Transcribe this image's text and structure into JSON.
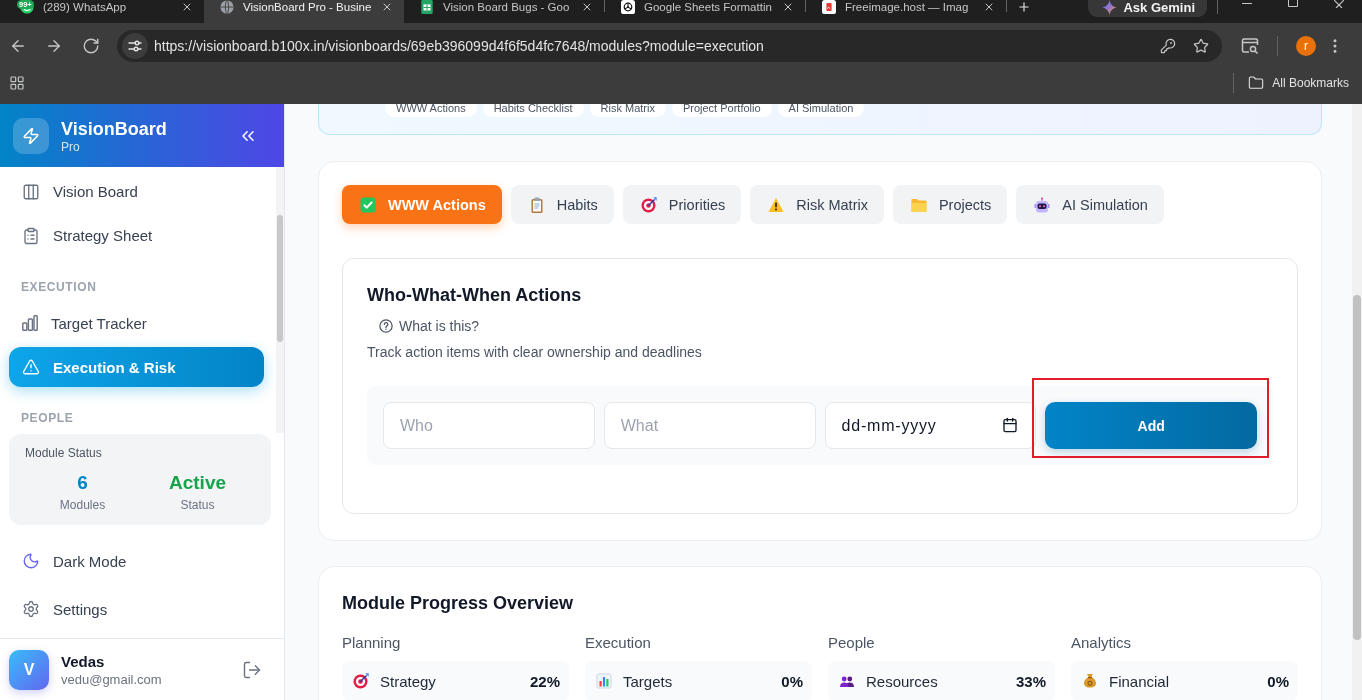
{
  "browser": {
    "tabs": [
      {
        "title": "(289) WhatsApp",
        "kind": "chat",
        "badge": "99+",
        "selected": false
      },
      {
        "title": "VisionBoard Pro - Busine",
        "kind": "globe",
        "selected": true
      },
      {
        "title": "Vision Board Bugs - Goo",
        "kind": "sheet",
        "selected": false
      },
      {
        "title": "Google Sheets Formattin",
        "kind": "knot",
        "selected": false
      },
      {
        "title": "Freeimage.host — Imag",
        "kind": "image",
        "selected": false
      }
    ],
    "assistant_button": "Ask Gemini",
    "url": "https://visionboard.b100x.in/visionboards/69eb396099d4f6f5d4fc7648/modules?module=execution",
    "profile_initial": "r",
    "bookmarks_folder": "All Bookmarks"
  },
  "sidebar": {
    "brand": {
      "name": "VisionBoard",
      "tier": "Pro"
    },
    "groups": [
      {
        "items": [
          {
            "label": "Vision Board",
            "kind": "columns",
            "selected": false
          },
          {
            "label": "Strategy Sheet",
            "kind": "clipboard",
            "selected": false
          }
        ]
      },
      {
        "heading": "EXECUTION",
        "items": [
          {
            "label": "Target Tracker",
            "kind": "chart",
            "selected": false
          },
          {
            "label": "Execution & Risk",
            "kind": "alert",
            "selected": true
          }
        ]
      },
      {
        "heading": "PEOPLE"
      }
    ],
    "status_card": {
      "title": "Module Status",
      "stats": [
        {
          "value": "6",
          "label": "Modules",
          "color": "#0284c7"
        },
        {
          "value": "Active",
          "label": "Status",
          "color": "#16a34a"
        }
      ]
    },
    "footer_items": [
      {
        "label": "Dark Mode",
        "kind": "moon"
      },
      {
        "label": "Settings",
        "kind": "gear"
      }
    ],
    "user": {
      "initial": "V",
      "name": "Vedas",
      "email": "vedu@gmail.com"
    }
  },
  "overview_chips": [
    "WWW Actions",
    "Habits Checklist",
    "Risk Matrix",
    "Project Portfolio",
    "AI Simulation"
  ],
  "module_tabs": [
    {
      "label": "WWW Actions",
      "kind": "check",
      "selected": true
    },
    {
      "label": "Habits",
      "kind": "clipboard",
      "selected": false
    },
    {
      "label": "Priorities",
      "kind": "target",
      "selected": false
    },
    {
      "label": "Risk Matrix",
      "kind": "warning",
      "selected": false
    },
    {
      "label": "Projects",
      "kind": "folder",
      "selected": false
    },
    {
      "label": "AI Simulation",
      "kind": "robot",
      "selected": false
    }
  ],
  "actions_panel": {
    "title": "Who-What-When Actions",
    "help_link": "What is this?",
    "description": "Track action items with clear ownership and deadlines",
    "fields": [
      {
        "kind": "text",
        "placeholder": "Who"
      },
      {
        "kind": "text",
        "placeholder": "What"
      },
      {
        "kind": "date",
        "placeholder": "dd-mm-yyyy"
      }
    ],
    "add_button": {
      "label": "Add",
      "highlighted": true
    }
  },
  "progress_overview": {
    "title": "Module Progress Overview",
    "groups": [
      {
        "heading": "Planning",
        "items": [
          {
            "label": "Strategy",
            "value": "22%",
            "kind": "target"
          }
        ]
      },
      {
        "heading": "Execution",
        "items": [
          {
            "label": "Targets",
            "value": "0%",
            "kind": "chart"
          }
        ]
      },
      {
        "heading": "People",
        "items": [
          {
            "label": "Resources",
            "value": "33%",
            "kind": "people"
          }
        ]
      },
      {
        "heading": "Analytics",
        "items": [
          {
            "label": "Financial",
            "value": "0%",
            "kind": "moneybag"
          }
        ]
      }
    ]
  }
}
